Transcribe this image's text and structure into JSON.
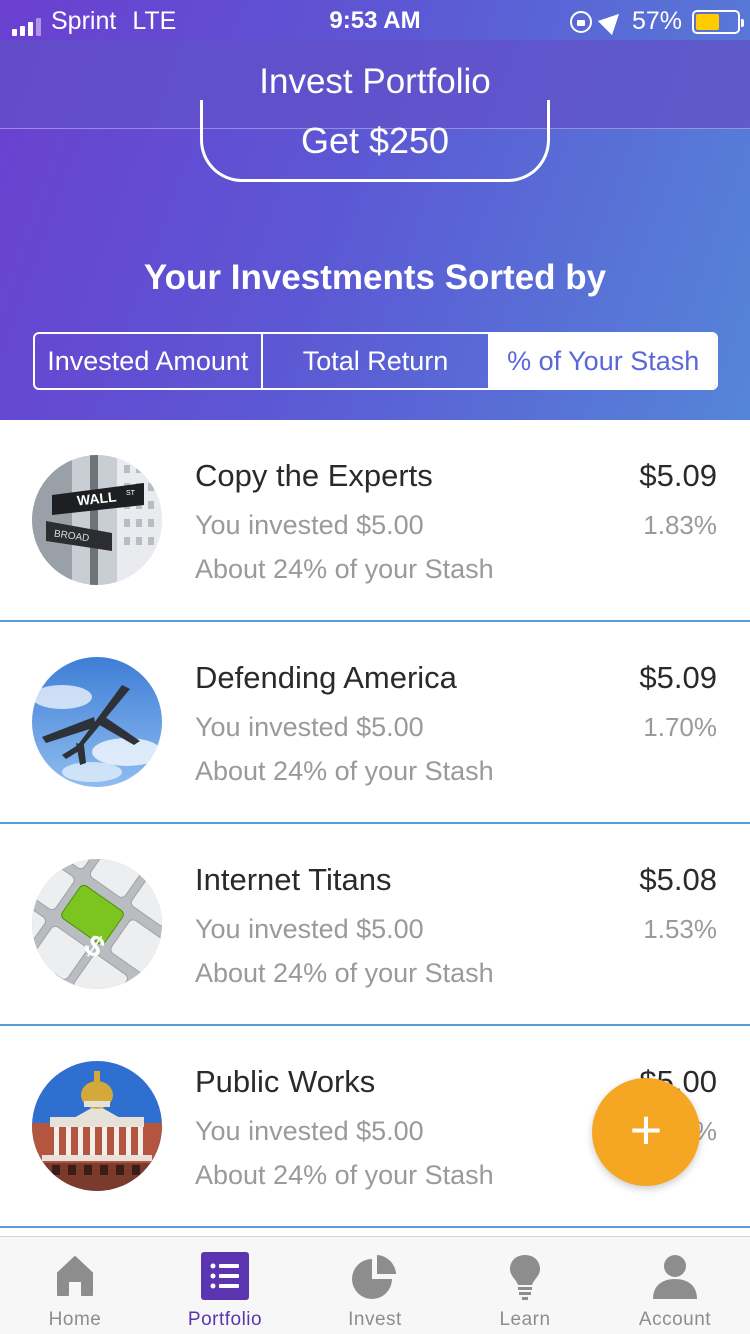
{
  "status_bar": {
    "carrier": "Sprint",
    "network": "LTE",
    "time": "9:53 AM",
    "battery": "57%",
    "battery_level": 0.57,
    "icons": [
      "signal-icon",
      "rotation-lock-icon",
      "location-arrow-icon",
      "battery-icon"
    ]
  },
  "header": {
    "title": "Invest Portfolio"
  },
  "promo": {
    "button_label": "Get $250"
  },
  "sort": {
    "title": "Your Investments Sorted by",
    "options": [
      "Invested Amount",
      "Total Return",
      "% of Your Stash"
    ],
    "selected": "% of Your Stash"
  },
  "investments": [
    {
      "name": "Copy the Experts",
      "value": "$5.09",
      "invested": "You invested $5.00",
      "return": "1.83%",
      "share": "About 24% of your Stash",
      "image": "wall-street-sign"
    },
    {
      "name": "Defending America",
      "value": "$5.09",
      "invested": "You invested $5.00",
      "return": "1.70%",
      "share": "About 24% of your Stash",
      "image": "fighter-jet"
    },
    {
      "name": "Internet Titans",
      "value": "$5.08",
      "invested": "You invested $5.00",
      "return": "1.53%",
      "share": "About 24% of your Stash",
      "image": "dollar-keyboard-key"
    },
    {
      "name": "Public Works",
      "value": "$5.00",
      "invested": "You invested $5.00",
      "return": "%",
      "share": "About 24% of your Stash",
      "image": "state-house-dome"
    }
  ],
  "fab": {
    "label": "+",
    "color": "#f5a623"
  },
  "tab_bar": {
    "tabs": [
      {
        "label": "Home",
        "icon": "home-icon"
      },
      {
        "label": "Portfolio",
        "icon": "portfolio-list-icon"
      },
      {
        "label": "Invest",
        "icon": "pie-chart-icon"
      },
      {
        "label": "Learn",
        "icon": "lightbulb-icon"
      },
      {
        "label": "Account",
        "icon": "person-icon"
      }
    ],
    "active": "Portfolio"
  },
  "colors": {
    "gradient_start": "#6b3fd0",
    "gradient_end": "#5585d8",
    "accent": "#5b35b0",
    "divider": "#5a9bd5",
    "active_segment_text": "#5a67d8"
  }
}
